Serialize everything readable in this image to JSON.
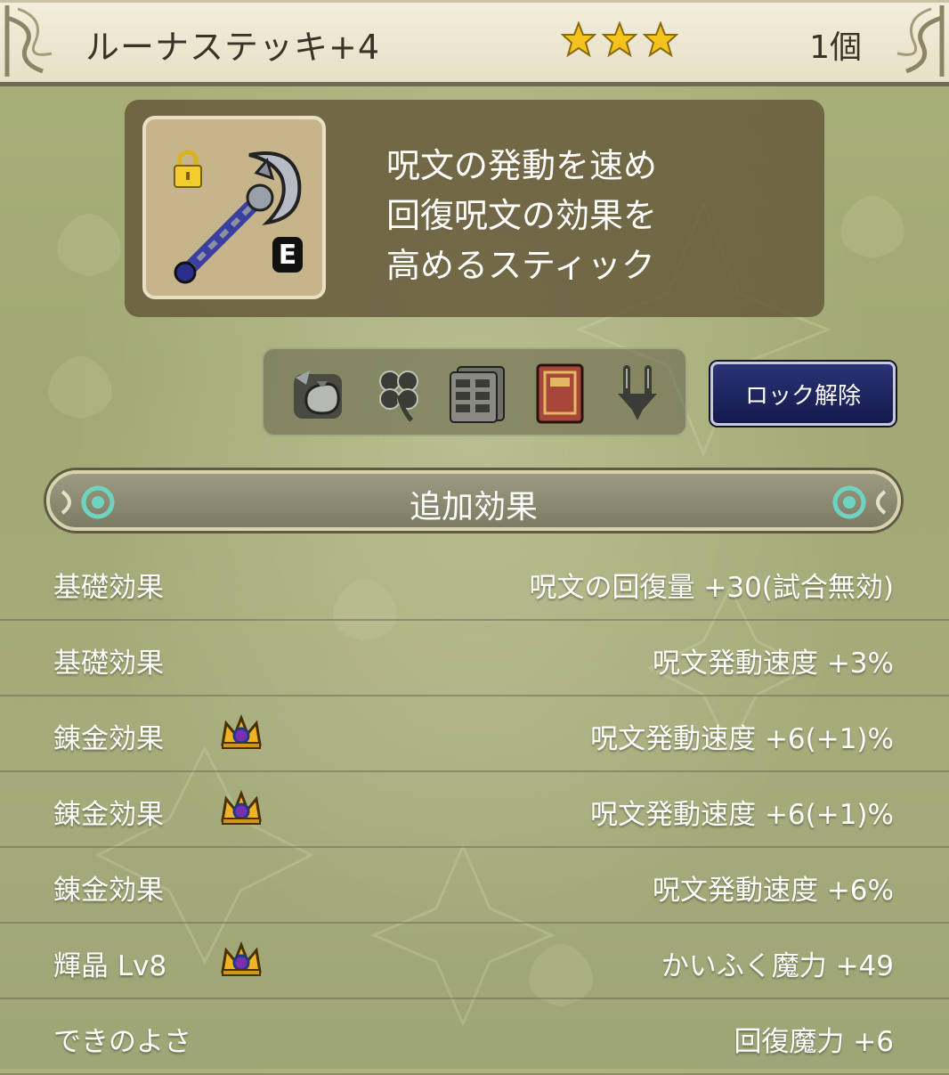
{
  "header": {
    "item_name": "ルーナステッキ+4",
    "stars": 3,
    "count": "1個"
  },
  "item": {
    "equip_badge": "E",
    "description": [
      "呪文の発動を速め",
      "回復呪文の効果を",
      "高めるスティック"
    ]
  },
  "actions": {
    "icons": [
      "sell-bag-icon",
      "clover-icon",
      "storage-icon",
      "book-icon",
      "fork-icon"
    ],
    "unlock_label": "ロック解除"
  },
  "section": {
    "title": "追加効果"
  },
  "effects": [
    {
      "label": "基礎効果",
      "value": "呪文の回復量 +30(試合無効)",
      "crown": false
    },
    {
      "label": "基礎効果",
      "value": "呪文発動速度 +3%",
      "crown": false
    },
    {
      "label": "錬金効果",
      "value": "呪文発動速度 +6(+1)%",
      "crown": true
    },
    {
      "label": "錬金効果",
      "value": "呪文発動速度 +6(+1)%",
      "crown": true
    },
    {
      "label": "錬金効果",
      "value": "呪文発動速度 +6%",
      "crown": false
    },
    {
      "label": "輝晶 Lv8",
      "value": "かいふく魔力 +49",
      "crown": true
    },
    {
      "label": "できのよさ",
      "value": "回復魔力 +6",
      "crown": false
    }
  ],
  "colors": {
    "star": "#f4c21d",
    "unlock_button": "#1f276a",
    "crown": "#f0b323"
  }
}
